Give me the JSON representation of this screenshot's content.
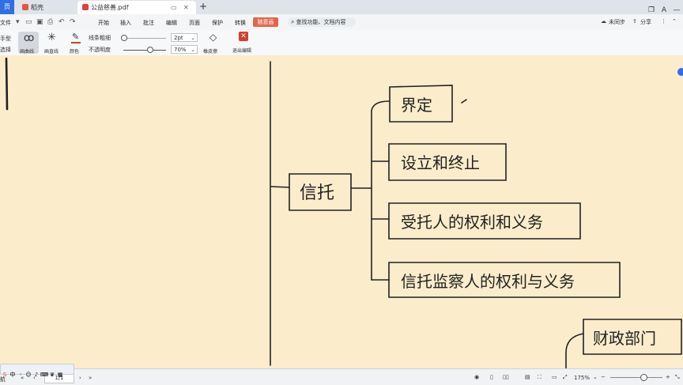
{
  "tabs": {
    "home": "页",
    "items": [
      {
        "label": "稻壳",
        "icon_color": "#e8553f"
      },
      {
        "label": "公益慈善.pdf",
        "icon_color": "#e0423a"
      }
    ],
    "new_tab": "+",
    "window_controls": [
      "❐",
      "A",
      "—"
    ]
  },
  "menubar": {
    "file": "文件",
    "items": [
      "开始",
      "插入",
      "批注",
      "编辑",
      "页面",
      "保护",
      "转换"
    ],
    "active_tab": "随意画",
    "search_placeholder": "查找功能、文档内容",
    "right": [
      "未同步",
      "分享"
    ]
  },
  "toolbar": {
    "hand_tool": [
      "手型",
      "选择"
    ],
    "curve_pen": "画曲线",
    "straight_line": "画直线",
    "color": "颜色",
    "line_thickness_label": "线条粗细",
    "opacity_label": "不透明度",
    "thickness_value": "2pt",
    "opacity_value": "70%",
    "eraser": "橡皮擦",
    "exit": "退出编辑"
  },
  "mindmap": {
    "root": "信托",
    "branches": [
      "界定",
      "设立和终止",
      "受托人的权利和义务",
      "信托监察人的权利与义务"
    ],
    "next_node": "财政部门"
  },
  "statusbar": {
    "nav": "航",
    "page": "1/1",
    "zoom": "175%"
  },
  "colors": {
    "accent": "#e6644a",
    "canvas": "#fbeccb",
    "brand_blue": "#2f6fe4"
  }
}
